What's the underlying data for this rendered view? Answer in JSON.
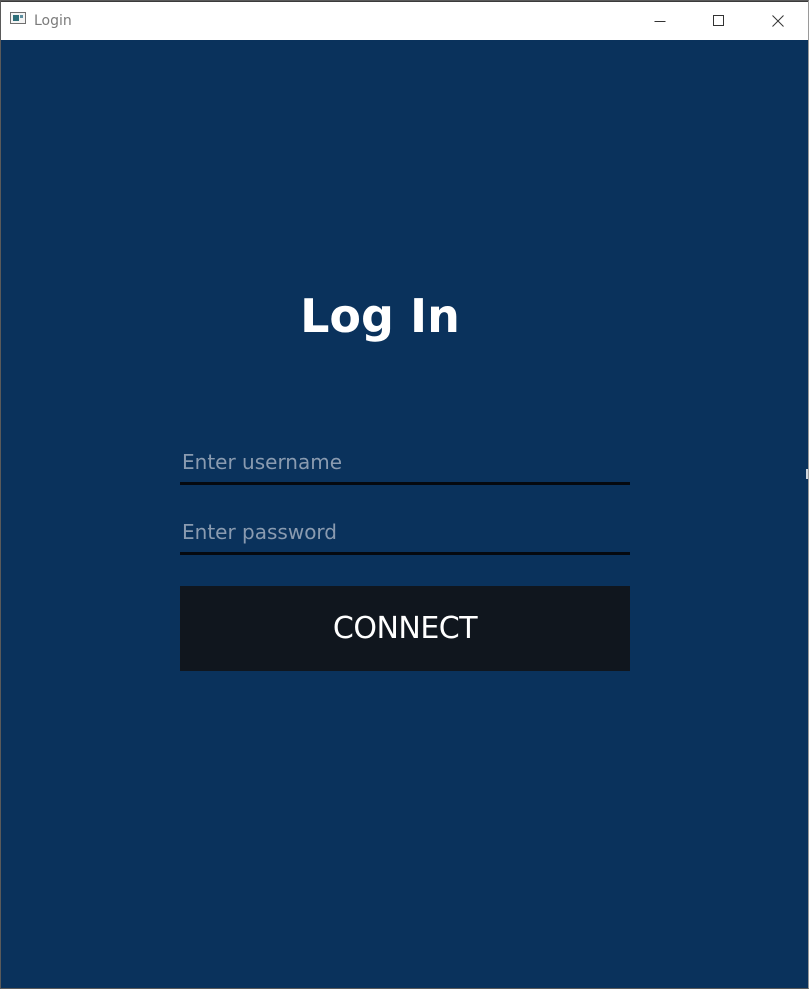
{
  "window": {
    "title": "Login",
    "controls": {
      "minimize_icon": "minimize-icon",
      "maximize_icon": "maximize-icon",
      "close_icon": "close-icon"
    }
  },
  "login": {
    "heading": "Log In",
    "username": {
      "value": "",
      "placeholder": "Enter username"
    },
    "password": {
      "value": "",
      "placeholder": "Enter password"
    },
    "connect_label": "CONNECT"
  },
  "colors": {
    "background": "#0a325c",
    "button": "#10161e",
    "field_underline": "#05090f",
    "placeholder": "#8a9bb0",
    "text": "#ffffff"
  }
}
